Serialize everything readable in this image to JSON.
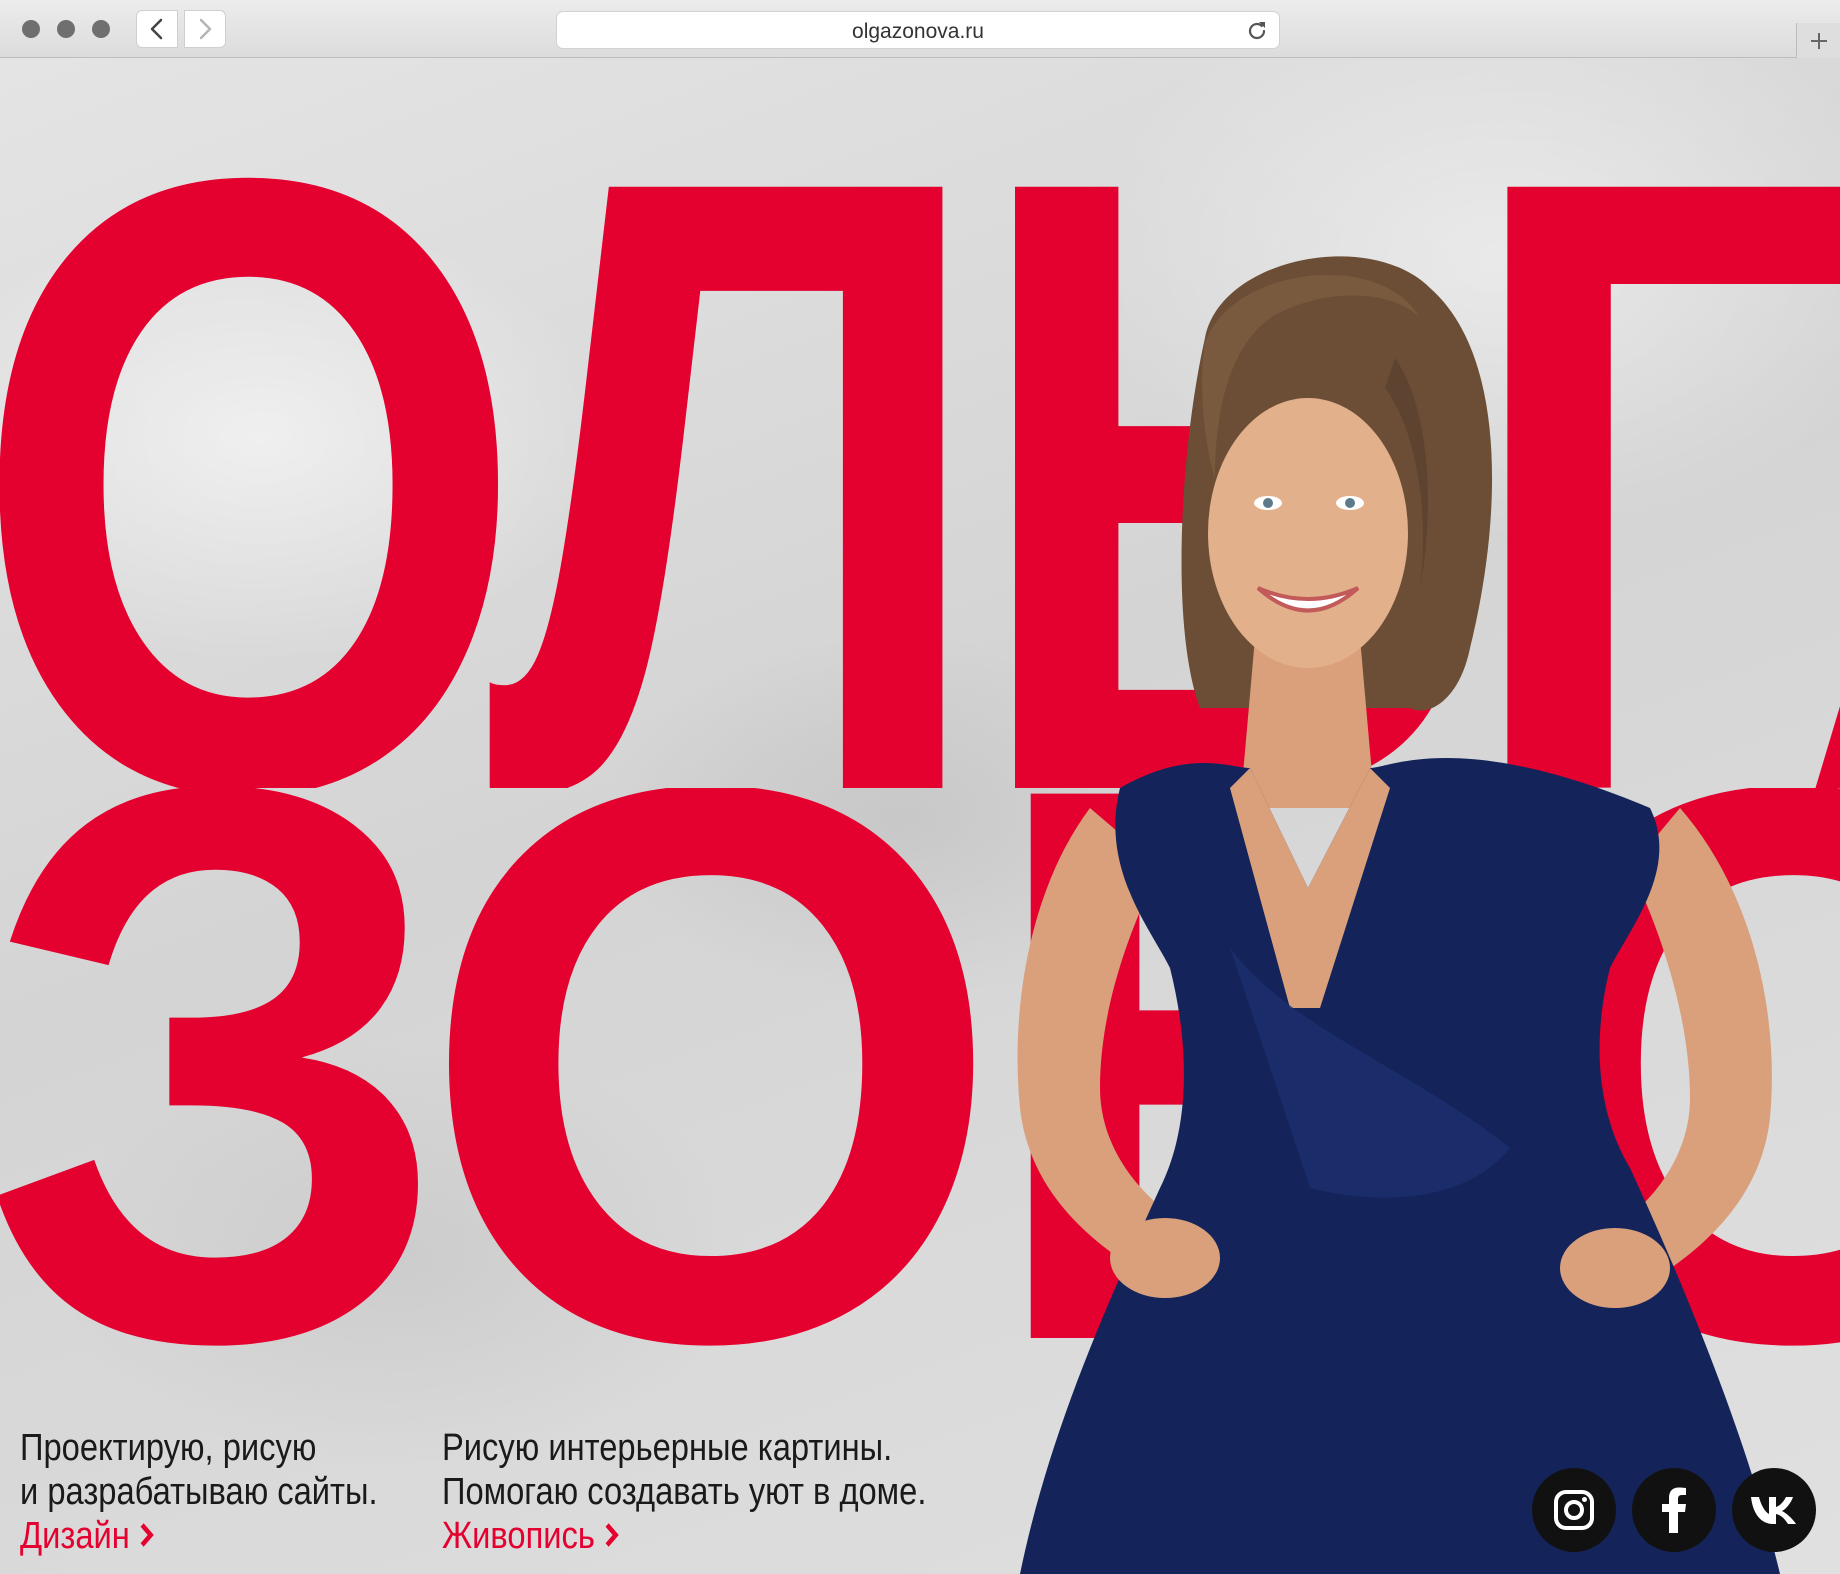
{
  "browser": {
    "url": "olgazonova.ru",
    "icons": [
      "back-icon",
      "forward-icon",
      "reload-icon",
      "plus-icon"
    ]
  },
  "hero": {
    "first_name": "ОЛЬГА",
    "last_name": "ЗОНОВА"
  },
  "services": {
    "design": {
      "line1": "Проектирую, рисую",
      "line2": "и разрабатываю сайты.",
      "link": "Дизайн"
    },
    "painting": {
      "line1": "Рисую интерьерные картины.",
      "line2": "Помогаю создавать уют в доме.",
      "link": "Живопись"
    }
  },
  "social": {
    "items": [
      "instagram-icon",
      "facebook-icon",
      "vk-icon"
    ]
  },
  "colors": {
    "accent": "#e4002f",
    "text": "#1a1a1a",
    "dress": "#14245a",
    "social_bg": "#111111"
  }
}
